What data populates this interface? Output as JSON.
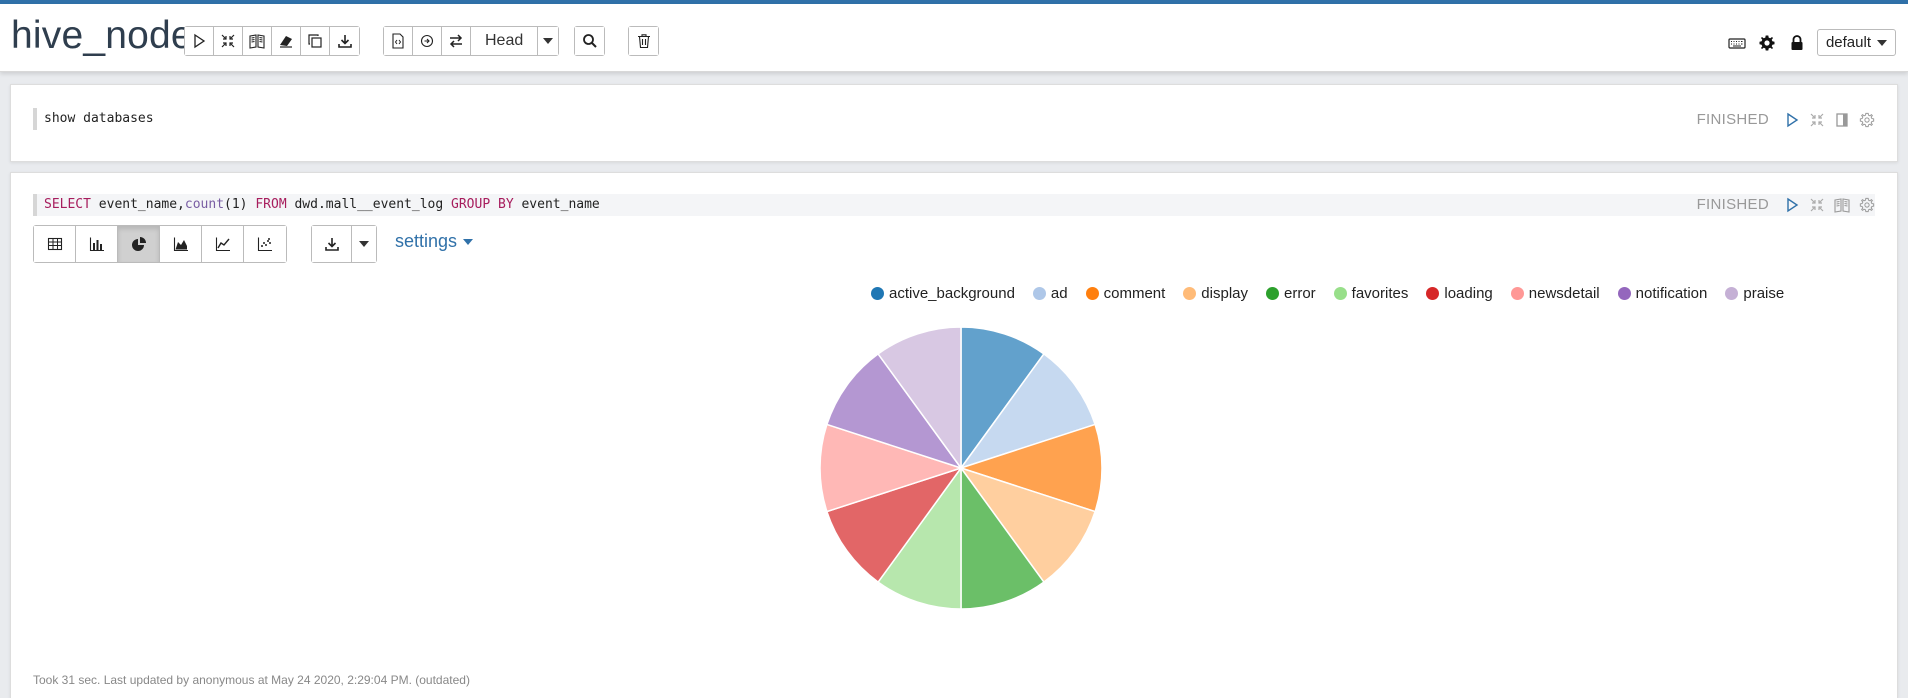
{
  "header": {
    "title": "hive_node",
    "head_label": "Head",
    "interpreter_label": "default"
  },
  "paragraphs": [
    {
      "code": "show databases",
      "status": "FINISHED"
    },
    {
      "code_parts": {
        "kw1": "SELECT",
        "t1": " event_name,",
        "fn": "count",
        "t2": "(1) ",
        "kw2": "FROM",
        "t3": " dwd.mall__event_log ",
        "kw3": "GROUP BY",
        "t4": " event_name"
      },
      "status": "FINISHED",
      "settings_label": "settings",
      "footer": "Took 31 sec. Last updated by anonymous at May 24 2020, 2:29:04 PM. (outdated)"
    }
  ],
  "icons": {
    "run": "play-icon",
    "hide": "compress-icon",
    "book": "book-icon",
    "clear": "eraser-icon",
    "clone": "copy-icon",
    "export": "download-icon",
    "version": "file-code-icon",
    "commit": "circle-arrow-icon",
    "revisions": "exchange-icon",
    "search": "search-icon",
    "trash": "trash-icon",
    "keyboard": "keyboard-icon",
    "gear": "gear-icon",
    "lock": "lock-icon"
  },
  "chart_data": {
    "type": "pie",
    "title": "",
    "legend_position": "top",
    "categories": [
      "active_background",
      "ad",
      "comment",
      "display",
      "error",
      "favorites",
      "loading",
      "newsdetail",
      "notification",
      "praise"
    ],
    "values": [
      10,
      10,
      10,
      10,
      10,
      10,
      10,
      10,
      10,
      10
    ],
    "legend_colors": [
      "#1f77b4",
      "#aec7e8",
      "#ff7f0e",
      "#ffbb78",
      "#2ca02c",
      "#98df8a",
      "#d62728",
      "#ff9896",
      "#9467bd",
      "#c5b0d5"
    ],
    "slice_colors": [
      "#62a1cc",
      "#c6d9f0",
      "#ffa24f",
      "#ffcf9f",
      "#6bbf68",
      "#b7e7ad",
      "#e26667",
      "#ffb8b6",
      "#b497d2",
      "#d8c8e3"
    ]
  }
}
